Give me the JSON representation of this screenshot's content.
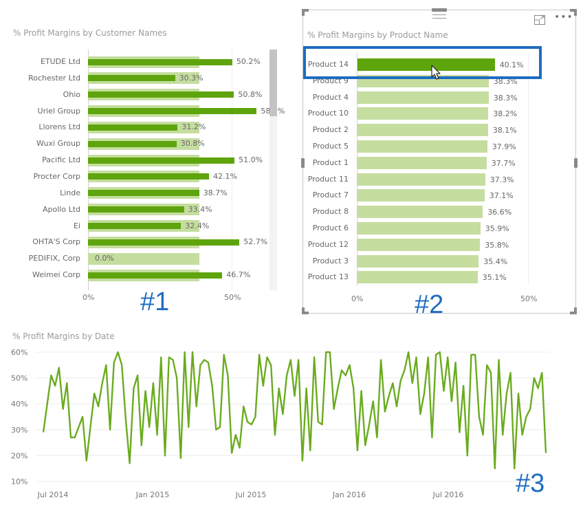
{
  "annotations": [
    "#1",
    "#2",
    "#3"
  ],
  "visual_header": {
    "focus_mode_icon": "focus-mode-icon",
    "more_options_icon": "more-options-icon",
    "drag_handle_icon": "drag-handle-icon"
  },
  "chart_data": [
    {
      "type": "bar",
      "orientation": "horizontal",
      "title": "% Profit Margins by Customer Names",
      "categories": [
        "ETUDE Ltd",
        "Rochester Ltd",
        "Ohio",
        "Uriel Group",
        "Llorens Ltd",
        "Wuxi Group",
        "Pacific Ltd",
        "Procter Corp",
        "Linde",
        "Apollo Ltd",
        "Ei",
        "OHTA'S Corp",
        "PEDIFIX, Corp",
        "Weimei Corp"
      ],
      "values": [
        50.2,
        30.3,
        50.8,
        58.7,
        31.2,
        30.8,
        51.0,
        42.1,
        38.7,
        33.4,
        32.4,
        52.7,
        0.0,
        46.7
      ],
      "value_labels": [
        "50.2%",
        "30.3%",
        "50.8%",
        "58.7%",
        "31.2%",
        "30.8%",
        "51.0%",
        "42.1%",
        "38.7%",
        "33.4%",
        "32.4%",
        "52.7%",
        "0.0%",
        "46.7%"
      ],
      "background_bar_value": 38.7,
      "xticks": [
        "0%",
        "50%"
      ],
      "xlim": [
        0,
        62
      ],
      "scrollbar": {
        "visible": true,
        "position_fraction": 0.0,
        "visible_fraction": 0.28
      },
      "colors": {
        "bar": "#5ea40c",
        "background_bar": "#c5dd9f"
      }
    },
    {
      "type": "bar",
      "orientation": "horizontal",
      "title": "% Profit Margins by Product Name",
      "categories": [
        "Product 14",
        "Product 9",
        "Product 4",
        "Product 10",
        "Product 2",
        "Product 5",
        "Product 1",
        "Product 11",
        "Product 7",
        "Product 8",
        "Product 6",
        "Product 12",
        "Product 3",
        "Product 13"
      ],
      "values": [
        40.1,
        38.3,
        38.3,
        38.2,
        38.1,
        37.9,
        37.7,
        37.3,
        37.1,
        36.6,
        35.9,
        35.8,
        35.4,
        35.1
      ],
      "value_labels": [
        "40.1%",
        "38.3%",
        "38.3%",
        "38.2%",
        "38.1%",
        "37.9%",
        "37.7%",
        "37.3%",
        "37.1%",
        "36.6%",
        "35.9%",
        "35.8%",
        "35.4%",
        "35.1%"
      ],
      "selected_category": "Product 14",
      "xticks": [
        "0%",
        "50%"
      ],
      "xlim": [
        0,
        50
      ],
      "colors": {
        "selected_bar": "#5ea40c",
        "bar": "#c5dd9f",
        "selection_highlight": "#1f6cc1"
      }
    },
    {
      "type": "line",
      "title": "% Profit Margins by Date",
      "yticks": [
        "60%",
        "50%",
        "40%",
        "30%",
        "20%",
        "10%"
      ],
      "ylim": [
        10,
        60
      ],
      "xticks": [
        "Jul 2014",
        "Jan 2015",
        "Jul 2015",
        "Jan 2016",
        "Jul 2016"
      ],
      "x_range": [
        "2014-06",
        "2016-11"
      ],
      "grid": true,
      "color": "#6aab1f",
      "series": [
        {
          "name": "% Profit Margins",
          "values": [
            29,
            40,
            51,
            47,
            54,
            38,
            48,
            27,
            27,
            31,
            35,
            18,
            31,
            44,
            39,
            48,
            55,
            30,
            56,
            60,
            55,
            34,
            17,
            46,
            51,
            24,
            45,
            31,
            48,
            28,
            58,
            20,
            58,
            57,
            50,
            19,
            60,
            31,
            60,
            39,
            55,
            57,
            56,
            47,
            30,
            31,
            59,
            51,
            21,
            28,
            23,
            39,
            33,
            32,
            35,
            59,
            47,
            58,
            55,
            28,
            46,
            36,
            51,
            57,
            43,
            57,
            18,
            46,
            22,
            58,
            33,
            32,
            60,
            60,
            38,
            46,
            53,
            51,
            55,
            46,
            22,
            45,
            24,
            32,
            41,
            27,
            57,
            37,
            43,
            48,
            39,
            49,
            53,
            60,
            48,
            58,
            36,
            44,
            58,
            27,
            59,
            60,
            45,
            58,
            41,
            56,
            29,
            47,
            20,
            59,
            59,
            35,
            28,
            55,
            52,
            15,
            57,
            28,
            44,
            52,
            15,
            44,
            28,
            35,
            38,
            50,
            46,
            52,
            21
          ]
        }
      ]
    }
  ]
}
